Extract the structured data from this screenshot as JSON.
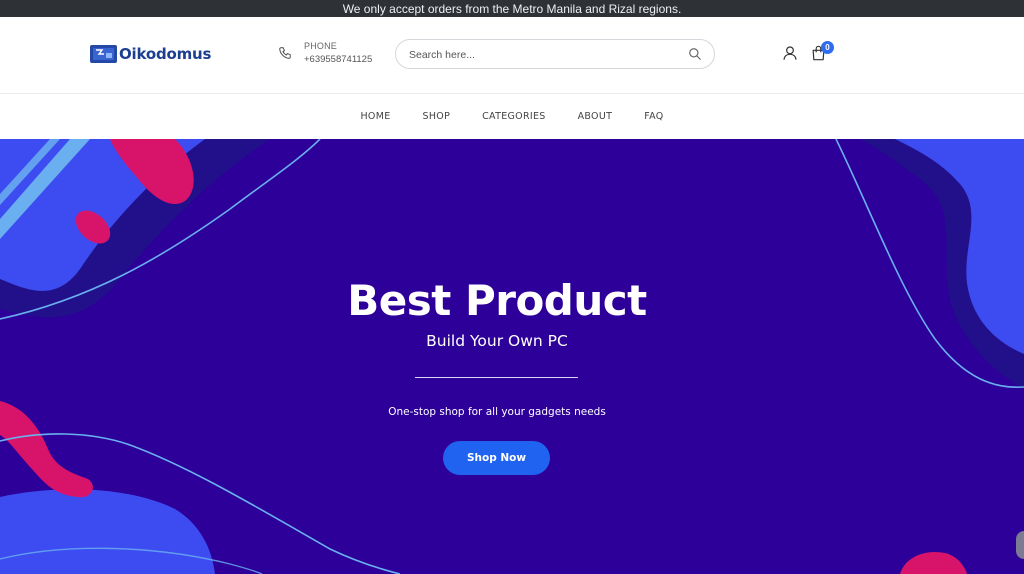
{
  "announcement": "We only accept orders from the Metro Manila and Rizal regions.",
  "brand": {
    "name": "Oikodomus",
    "color": "#1d3f91"
  },
  "contact": {
    "label": "PHONE",
    "number": "+639558741125"
  },
  "search": {
    "placeholder": "Search here..."
  },
  "cart": {
    "count": "0"
  },
  "nav": {
    "items": [
      "HOME",
      "SHOP",
      "CATEGORIES",
      "ABOUT",
      "FAQ"
    ]
  },
  "hero": {
    "title": "Best Product",
    "subtitle": "Build Your Own PC",
    "tagline": "One-stop shop for all your gadgets needs",
    "cta": "Shop Now"
  },
  "colors": {
    "topbar": "#2e3136",
    "hero_background": "#2c0099",
    "accent_blue": "#1f63f0",
    "shape_blue": "#3d4cf0",
    "shape_pink": "#d8146a",
    "line_light_blue": "#6ab0f0"
  },
  "icons": {
    "phone": "phone-icon",
    "search": "search-icon",
    "account": "user-icon",
    "cart": "shopping-bag-icon"
  }
}
